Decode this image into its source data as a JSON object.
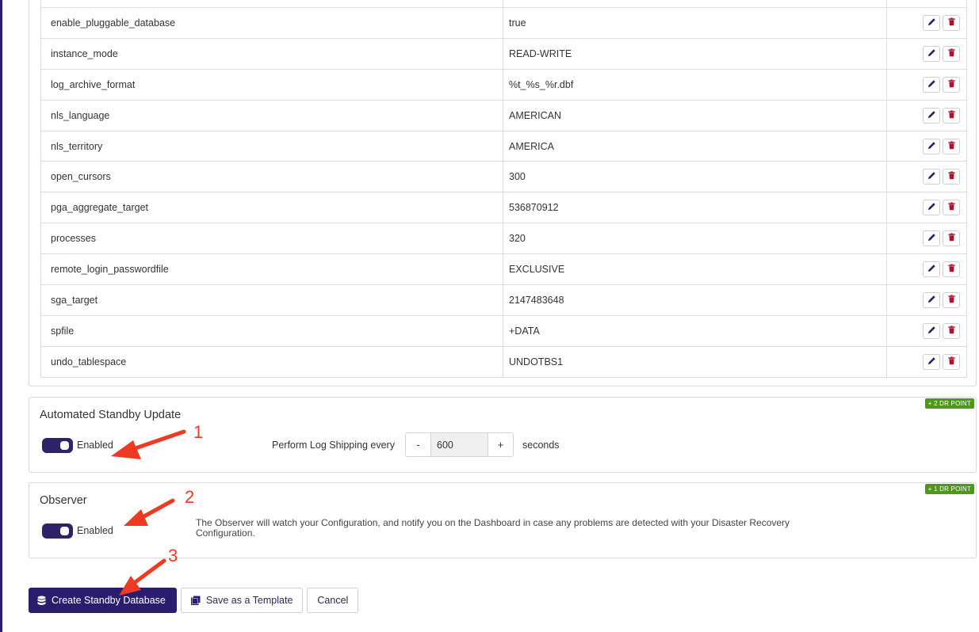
{
  "parameters": [
    {
      "name": "enable_pluggable_database",
      "value": "true"
    },
    {
      "name": "instance_mode",
      "value": "READ-WRITE"
    },
    {
      "name": "log_archive_format",
      "value": "%t_%s_%r.dbf"
    },
    {
      "name": "nls_language",
      "value": "AMERICAN"
    },
    {
      "name": "nls_territory",
      "value": "AMERICA"
    },
    {
      "name": "open_cursors",
      "value": "300"
    },
    {
      "name": "pga_aggregate_target",
      "value": "536870912"
    },
    {
      "name": "processes",
      "value": "320"
    },
    {
      "name": "remote_login_passwordfile",
      "value": "EXCLUSIVE"
    },
    {
      "name": "sga_target",
      "value": "2147483648"
    },
    {
      "name": "spfile",
      "value": "+DATA"
    },
    {
      "name": "undo_tablespace",
      "value": "UNDOTBS1"
    }
  ],
  "row_actions": {
    "edit_icon": "pencil-icon",
    "delete_icon": "trash-icon"
  },
  "standby_update": {
    "title": "Automated Standby Update",
    "badge": "+ 2 DR POINT",
    "toggle_label": "Enabled",
    "toggle_on": true,
    "shipping_label": "Perform Log Shipping every",
    "decrement": "-",
    "interval": "600",
    "increment": "+",
    "unit": "seconds"
  },
  "observer": {
    "title": "Observer",
    "badge": "+ 1 DR POINT",
    "toggle_label": "Enabled",
    "toggle_on": true,
    "description": "The Observer will watch your Configuration, and notify you on the Dashboard in case any problems are detected with your Disaster Recovery Configuration."
  },
  "buttons": {
    "create": "Create Standby Database",
    "template": "Save as a Template",
    "cancel": "Cancel"
  },
  "annotations": [
    "1",
    "2",
    "3"
  ],
  "colors": {
    "primary": "#2b1d6e",
    "delete": "#b0122b",
    "badge": "#4d9a1a",
    "annotation": "#ee3a23"
  }
}
